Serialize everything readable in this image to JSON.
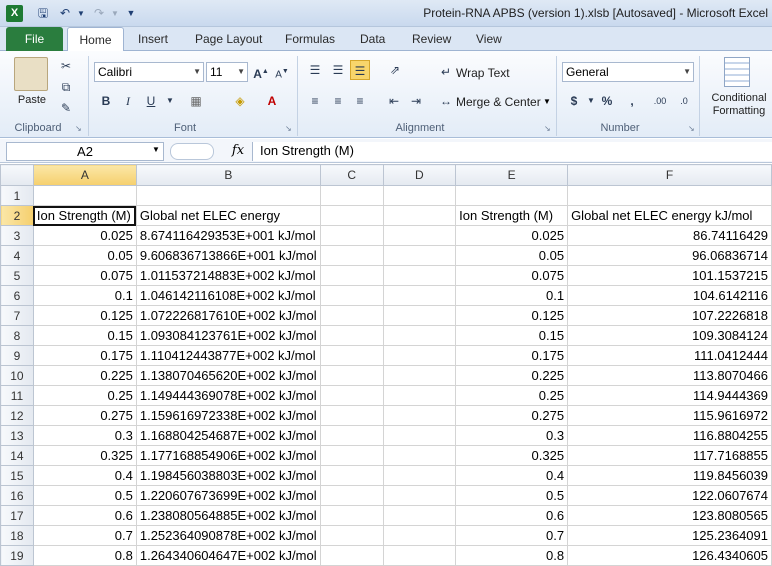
{
  "window": {
    "title": "Protein-RNA APBS (version 1).xlsb [Autosaved]  -  Microsoft Excel",
    "app_icon": "X"
  },
  "quick_access": {
    "save_icon": "save-icon",
    "undo_icon": "undo-icon",
    "redo_icon": "redo-icon"
  },
  "ribbon": {
    "tabs": [
      "File",
      "Home",
      "Insert",
      "Page Layout",
      "Formulas",
      "Data",
      "Review",
      "View"
    ],
    "clipboard": {
      "paste": "Paste",
      "group": "Clipboard"
    },
    "font": {
      "name": "Calibri",
      "size": "11",
      "bold": "B",
      "italic": "I",
      "underline": "U",
      "group": "Font"
    },
    "alignment": {
      "wrap": "Wrap Text",
      "merge": "Merge & Center",
      "group": "Alignment"
    },
    "number": {
      "format": "General",
      "currency": "$",
      "percent": "%",
      "comma": ",",
      "inc": ".00",
      "dec": ".0",
      "group": "Number"
    },
    "styles": {
      "cond1": "Conditional",
      "cond2": "Formatting"
    }
  },
  "formula_bar": {
    "name_box": "A2",
    "fx": "fx",
    "formula": "Ion Strength (M)"
  },
  "sheet": {
    "columns": [
      "A",
      "B",
      "C",
      "D",
      "E",
      "F"
    ],
    "rows": [
      {
        "n": "1",
        "a": "",
        "b": "",
        "e": "",
        "f": ""
      },
      {
        "n": "2",
        "a": "Ion Strength (M)",
        "b": "Global net ELEC energy",
        "e": "Ion Strength (M)",
        "f": "Global net ELEC energy kJ/mol"
      },
      {
        "n": "3",
        "a": "0.025",
        "b": "8.674116429353E+001 kJ/mol",
        "e": "0.025",
        "f": "86.74116429"
      },
      {
        "n": "4",
        "a": "0.05",
        "b": "9.606836713866E+001 kJ/mol",
        "e": "0.05",
        "f": "96.06836714"
      },
      {
        "n": "5",
        "a": "0.075",
        "b": "1.011537214883E+002 kJ/mol",
        "e": "0.075",
        "f": "101.1537215"
      },
      {
        "n": "6",
        "a": "0.1",
        "b": "1.046142116108E+002 kJ/mol",
        "e": "0.1",
        "f": "104.6142116"
      },
      {
        "n": "7",
        "a": "0.125",
        "b": "1.072226817610E+002 kJ/mol",
        "e": "0.125",
        "f": "107.2226818"
      },
      {
        "n": "8",
        "a": "0.15",
        "b": "1.093084123761E+002 kJ/mol",
        "e": "0.15",
        "f": "109.3084124"
      },
      {
        "n": "9",
        "a": "0.175",
        "b": "1.110412443877E+002 kJ/mol",
        "e": "0.175",
        "f": "111.0412444"
      },
      {
        "n": "10",
        "a": "0.225",
        "b": "1.138070465620E+002 kJ/mol",
        "e": "0.225",
        "f": "113.8070466"
      },
      {
        "n": "11",
        "a": "0.25",
        "b": "1.149444369078E+002 kJ/mol",
        "e": "0.25",
        "f": "114.9444369"
      },
      {
        "n": "12",
        "a": "0.275",
        "b": "1.159616972338E+002 kJ/mol",
        "e": "0.275",
        "f": "115.9616972"
      },
      {
        "n": "13",
        "a": "0.3",
        "b": "1.168804254687E+002 kJ/mol",
        "e": "0.3",
        "f": "116.8804255"
      },
      {
        "n": "14",
        "a": "0.325",
        "b": "1.177168854906E+002 kJ/mol",
        "e": "0.325",
        "f": "117.7168855"
      },
      {
        "n": "15",
        "a": "0.4",
        "b": "1.198456038803E+002 kJ/mol",
        "e": "0.4",
        "f": "119.8456039"
      },
      {
        "n": "16",
        "a": "0.5",
        "b": "1.220607673699E+002 kJ/mol",
        "e": "0.5",
        "f": "122.0607674"
      },
      {
        "n": "17",
        "a": "0.6",
        "b": "1.238080564885E+002 kJ/mol",
        "e": "0.6",
        "f": "123.8080565"
      },
      {
        "n": "18",
        "a": "0.7",
        "b": "1.252364090878E+002 kJ/mol",
        "e": "0.7",
        "f": "125.2364091"
      },
      {
        "n": "19",
        "a": "0.8",
        "b": "1.264340604647E+002 kJ/mol",
        "e": "0.8",
        "f": "126.4340605"
      }
    ]
  }
}
